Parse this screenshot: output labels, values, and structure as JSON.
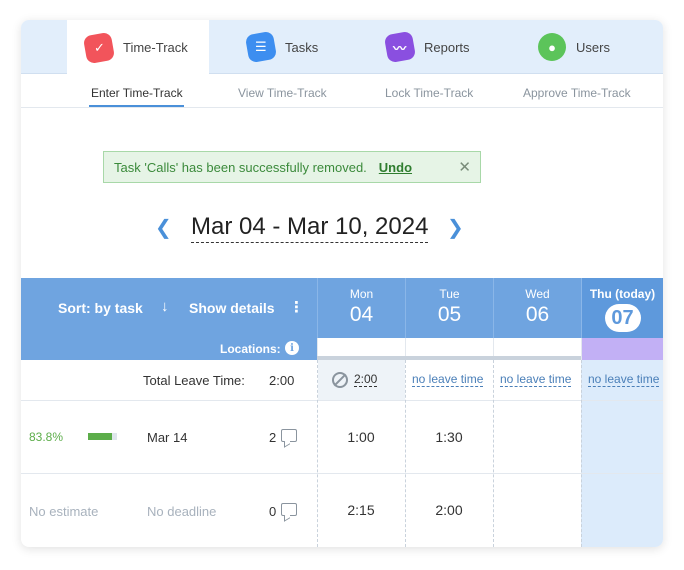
{
  "top_tabs": [
    {
      "label": "Time-Track",
      "icon": "checkmark-icon",
      "color": "#f2545b",
      "active": true
    },
    {
      "label": "Tasks",
      "icon": "list-icon",
      "color": "#3d8ef0",
      "active": false
    },
    {
      "label": "Reports",
      "icon": "chart-icon",
      "color": "#8a4fe0",
      "active": false
    },
    {
      "label": "Users",
      "icon": "user-icon",
      "color": "#5cc45a",
      "active": false
    }
  ],
  "sub_tabs": [
    {
      "label": "Enter Time-Track",
      "active": true
    },
    {
      "label": "View Time-Track",
      "active": false
    },
    {
      "label": "Lock Time-Track",
      "active": false
    },
    {
      "label": "Approve Time-Track",
      "active": false
    }
  ],
  "toast": {
    "message": "Task 'Calls' has been successfully removed.",
    "undo_label": "Undo",
    "close_glyph": "✕"
  },
  "week": {
    "label": "Mar 04 - Mar 10, 2024",
    "prev_glyph": "❮",
    "next_glyph": "❯"
  },
  "grid_header": {
    "sort_label": "Sort: by task",
    "sort_arrow": "↓",
    "details_label": "Show details",
    "menu_glyph": "⋮",
    "locations_label": "Locations:",
    "info_glyph": "i"
  },
  "days": [
    {
      "name": "Mon",
      "num": "04",
      "today": false
    },
    {
      "name": "Tue",
      "num": "05",
      "today": false
    },
    {
      "name": "Wed",
      "num": "06",
      "today": false
    },
    {
      "name": "Thu (today)",
      "num": "07",
      "today": true
    }
  ],
  "leave_row": {
    "label": "Total Leave Time:",
    "total": "2:00",
    "mon": "2:00",
    "tue": "no leave time",
    "wed": "no leave time",
    "thu": "no leave time"
  },
  "tasks": [
    {
      "estimate": "83.8%",
      "progress": 0.838,
      "deadline": "Mar 14",
      "comments": "2",
      "mon": "1:00",
      "tue": "1:30",
      "wed": "",
      "thu": ""
    },
    {
      "estimate": "No estimate",
      "progress": null,
      "deadline": "No deadline",
      "comments": "0",
      "mon": "2:15",
      "tue": "2:00",
      "wed": "",
      "thu": ""
    }
  ],
  "colors": {
    "header_blue": "#6fa4e0",
    "today_strip": "#c2b0f5",
    "success_green": "#3b8a3b",
    "link_blue": "#4a90d9"
  }
}
